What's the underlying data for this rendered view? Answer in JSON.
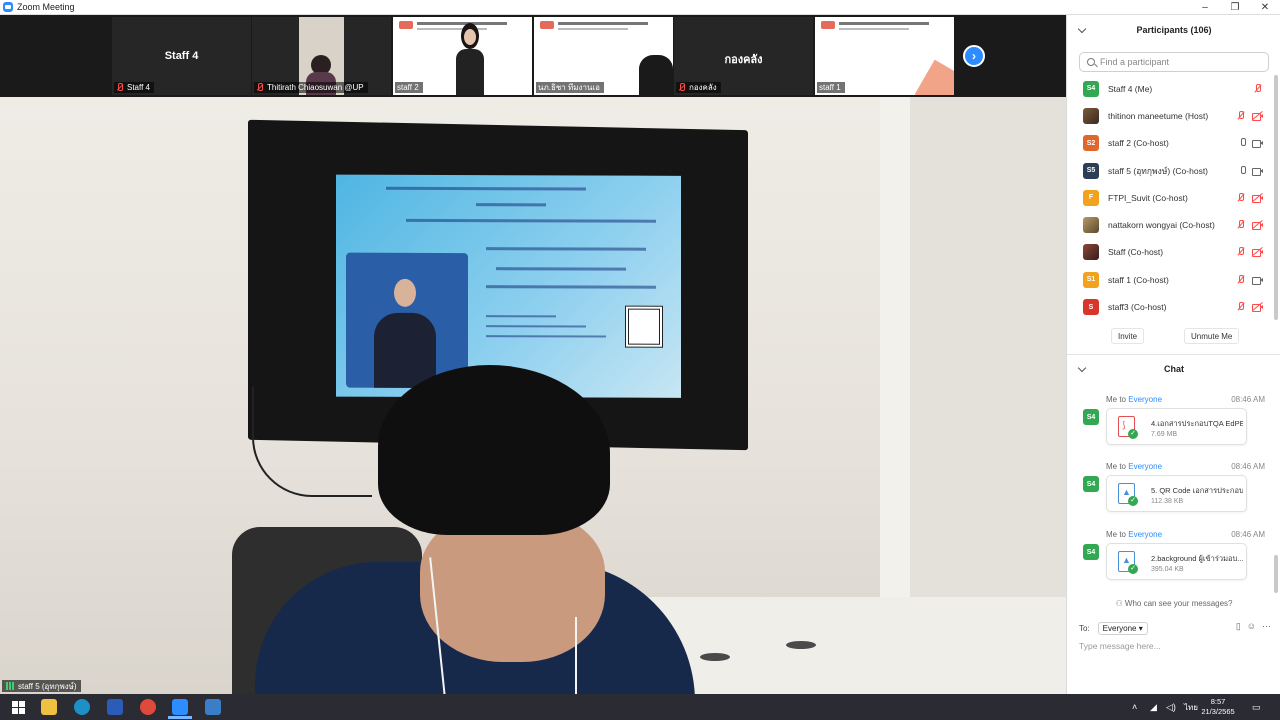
{
  "window": {
    "title": "Zoom Meeting",
    "controls": [
      "–",
      "❐",
      "✕"
    ]
  },
  "thumbnails": [
    {
      "name": "Staff 4",
      "center_name": "Staff 4",
      "type": "name"
    },
    {
      "name": "Thitirath Chiaosuwan @UP",
      "type": "camera"
    },
    {
      "name": "staff 2",
      "type": "slide"
    },
    {
      "name": "นภ.ธิชา ทีมงานเอ",
      "type": "slide"
    },
    {
      "name": "กองคลัง",
      "center_name": "กองคลัง",
      "type": "name"
    },
    {
      "name": "staff 1",
      "type": "slide"
    }
  ],
  "main_video": {
    "speaker_label": "staff 5 (อุทกุพงษ์)"
  },
  "participants": {
    "header": "Participants (106)",
    "search_placeholder": "Find a participant",
    "list": [
      {
        "name": "Staff 4 (Me)",
        "avatar": "S4",
        "color": "#32a852",
        "mic": "off",
        "video": "none"
      },
      {
        "name": "thitinon maneetume (Host)",
        "avatar": "",
        "color": "#7a5a3c",
        "mic": "off",
        "video": "off"
      },
      {
        "name": "staff 2 (Co-host)",
        "avatar": "S2",
        "color": "#e0662b",
        "mic": "on",
        "video": "on"
      },
      {
        "name": "staff 5 (อุทกุพงษ์) (Co-host)",
        "avatar": "S5",
        "color": "#2c3e55",
        "mic": "on",
        "video": "on"
      },
      {
        "name": "FTPI_Suvit (Co-host)",
        "avatar": "F",
        "color": "#f2a21c",
        "mic": "off",
        "video": "off"
      },
      {
        "name": "nattakorn wongyai (Co-host)",
        "avatar": "",
        "color": "#8a6a4a",
        "mic": "off",
        "video": "off"
      },
      {
        "name": "Staff (Co-host)",
        "avatar": "",
        "color": "#6b3a2a",
        "mic": "off",
        "video": "off"
      },
      {
        "name": "staff 1 (Co-host)",
        "avatar": "S1",
        "color": "#f2a21c",
        "mic": "off",
        "video": "on"
      },
      {
        "name": "staff3 (Co-host)",
        "avatar": "S",
        "color": "#d9352b",
        "mic": "off",
        "video": "off"
      }
    ],
    "invite_label": "Invite",
    "unmute_label": "Unmute Me"
  },
  "chat": {
    "header": "Chat",
    "messages": [
      {
        "from": "Me to ",
        "to": "Everyone",
        "time": "08:46 AM",
        "avatar": "S4",
        "file_name": "4.เอกสารประกอบTQA EdPE...",
        "file_size": "7.69 MB",
        "file_type": "pdf"
      },
      {
        "from": "Me to ",
        "to": "Everyone",
        "time": "08:46 AM",
        "avatar": "S4",
        "file_name": "5. QR Code เอกสารประกอบ ...",
        "file_size": "112.38 KB",
        "file_type": "img"
      },
      {
        "from": "Me to ",
        "to": "Everyone",
        "time": "08:46 AM",
        "avatar": "S4",
        "file_name": "2.background ผู้เข้าร่วมอบ...",
        "file_size": "395.04 KB",
        "file_type": "img"
      }
    ],
    "who_can_see": "Who can see your messages?",
    "to_label": "To:",
    "to_value": "Everyone",
    "input_placeholder": "Type message here..."
  },
  "taskbar": {
    "time": "8:57",
    "date": "21/3/2565",
    "tray_label": "ไทย"
  },
  "colors": {
    "accent": "#2d8cff",
    "mute_red": "#ff4a4a",
    "chat_avatar": "#32a852"
  }
}
